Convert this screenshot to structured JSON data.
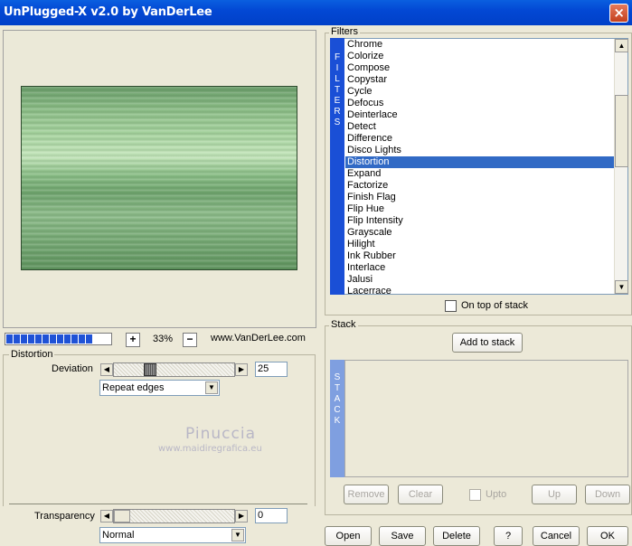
{
  "window": {
    "title": "UnPlugged-X v2.0 by VanDerLee",
    "close": "×"
  },
  "preview": {
    "zoom": "33%",
    "zoom_in": "+",
    "zoom_out": "−",
    "url": "www.VanDerLee.com",
    "progress_segments": 12
  },
  "distortion": {
    "group_label": "Distortion",
    "deviation_label": "Deviation",
    "deviation_value": "25",
    "edge_mode": "Repeat edges",
    "transparency_label": "Transparency",
    "transparency_value": "0",
    "blend_mode": "Normal"
  },
  "watermark": {
    "name": "Pinuccia",
    "site": "www.maidiregrafica.eu"
  },
  "filters": {
    "group_label": "Filters",
    "banner": [
      "F",
      "I",
      "L",
      "T",
      "E",
      "R",
      "S"
    ],
    "items": [
      "Chrome",
      "Colorize",
      "Compose",
      "Copystar",
      "Cycle",
      "Defocus",
      "Deinterlace",
      "Detect",
      "Difference",
      "Disco Lights",
      "Distortion",
      "Expand",
      "Factorize",
      "Finish Flag",
      "Flip Hue",
      "Flip Intensity",
      "Grayscale",
      "Hilight",
      "Ink Rubber",
      "Interlace",
      "Jalusi",
      "Lacerrace"
    ],
    "selected": "Distortion",
    "on_top_label": "On top of stack"
  },
  "stack": {
    "group_label": "Stack",
    "add_label": "Add to stack",
    "banner": [
      "S",
      "T",
      "A",
      "C",
      "K"
    ],
    "remove": "Remove",
    "clear": "Clear",
    "upto": "Upto",
    "up": "Up",
    "down": "Down"
  },
  "footer": {
    "open": "Open",
    "save": "Save",
    "delete": "Delete",
    "help": "?",
    "cancel": "Cancel",
    "ok": "OK"
  }
}
